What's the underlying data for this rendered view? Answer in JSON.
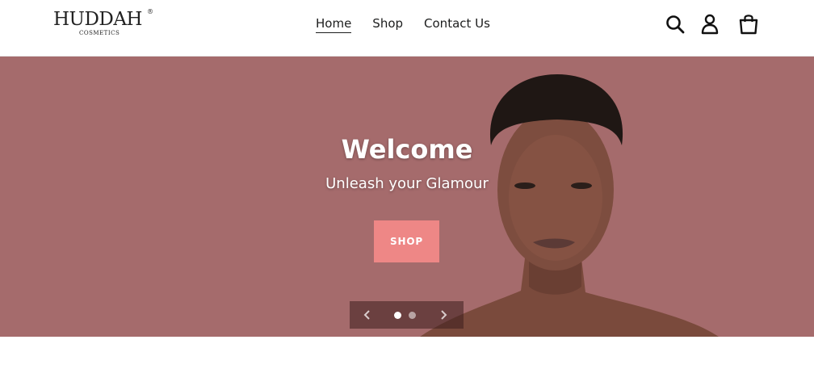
{
  "brand": {
    "name": "HUDDAH",
    "tagline": "COSMETICS",
    "reg_mark": "®"
  },
  "nav": {
    "items": [
      {
        "label": "Home",
        "active": true
      },
      {
        "label": "Shop",
        "active": false
      },
      {
        "label": "Contact Us",
        "active": false
      }
    ]
  },
  "header_icons": [
    "search-icon",
    "account-icon",
    "cart-icon"
  ],
  "hero": {
    "title": "Welcome",
    "subtitle": "Unleash your Glamour",
    "button_label": "SHOP",
    "background_color": "#a56b6c",
    "button_color": "#ee8786",
    "slides_total": 2,
    "active_slide": 1
  }
}
